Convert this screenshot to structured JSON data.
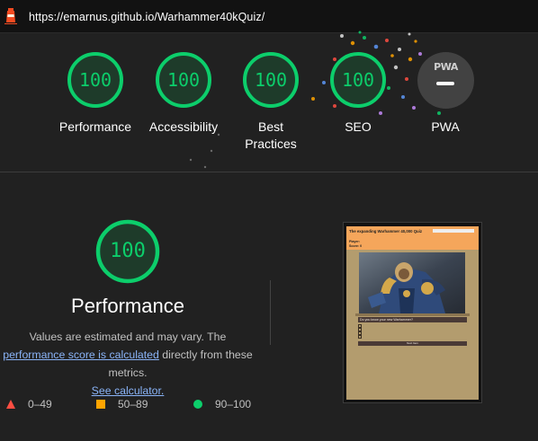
{
  "topbar": {
    "url": "https://emarnus.github.io/Warhammer40kQuiz/"
  },
  "categories": [
    {
      "label": "Performance",
      "score": "100"
    },
    {
      "label": "Accessibility",
      "score": "100"
    },
    {
      "label": "Best Practices",
      "score": "100"
    },
    {
      "label": "SEO",
      "score": "100"
    }
  ],
  "pwa": {
    "badge_text": "PWA",
    "label": "PWA"
  },
  "main": {
    "score": "100",
    "title": "Performance",
    "desc_part1": "Values are estimated and may vary. The",
    "desc_link1": "performance score is calculated",
    "desc_part2": "directly from these metrics.",
    "desc_link2": "See calculator."
  },
  "legend": {
    "fail": "0–49",
    "average": "50–89",
    "pass": "90–100"
  },
  "screenshot": {
    "title": "The expanding Warhammer 40,000 Quiz",
    "player_label": "Player:",
    "score_label": "Score: 0",
    "question": "Do you know your new Warhammer?",
    "submit": "Next Item"
  },
  "colors": {
    "pass": "#0cce6b",
    "average": "#ffa400",
    "fail": "#ff4e42",
    "background": "#212121",
    "link": "#8ab4f8"
  }
}
